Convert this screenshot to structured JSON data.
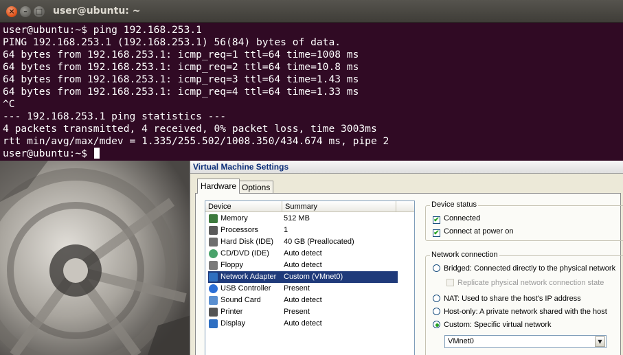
{
  "terminal": {
    "title": "user@ubuntu: ~",
    "buttons": {
      "close": "×",
      "minimize": "–",
      "maximize": "□"
    },
    "lines": [
      "user@ubuntu:~$ ping 192.168.253.1",
      "PING 192.168.253.1 (192.168.253.1) 56(84) bytes of data.",
      "64 bytes from 192.168.253.1: icmp_req=1 ttl=64 time=1008 ms",
      "64 bytes from 192.168.253.1: icmp_req=2 ttl=64 time=10.8 ms",
      "64 bytes from 192.168.253.1: icmp_req=3 ttl=64 time=1.43 ms",
      "64 bytes from 192.168.253.1: icmp_req=4 ttl=64 time=1.33 ms",
      "^C",
      "--- 192.168.253.1 ping statistics ---",
      "4 packets transmitted, 4 received, 0% packet loss, time 3003ms",
      "rtt min/avg/max/mdev = 1.335/255.502/1008.350/434.674 ms, pipe 2"
    ],
    "prompt": "user@ubuntu:~$ "
  },
  "dialog": {
    "title": "Virtual Machine Settings",
    "tabs": [
      "Hardware",
      "Options"
    ],
    "columns": [
      "Device",
      "Summary"
    ],
    "devices": [
      {
        "name": "Memory",
        "summary": "512 MB",
        "icon": "memory-icon",
        "color": "#3d7a3d"
      },
      {
        "name": "Processors",
        "summary": "1",
        "icon": "processor-icon",
        "color": "#5a5a5a"
      },
      {
        "name": "Hard Disk (IDE)",
        "summary": "40 GB (Preallocated)",
        "icon": "hard-disk-icon",
        "color": "#6e6e6e"
      },
      {
        "name": "CD/DVD (IDE)",
        "summary": "Auto detect",
        "icon": "cd-dvd-icon",
        "color": "#4aa36b"
      },
      {
        "name": "Floppy",
        "summary": "Auto detect",
        "icon": "floppy-icon",
        "color": "#7a7a7a"
      },
      {
        "name": "Network Adapter",
        "summary": "Custom (VMnet0)",
        "icon": "network-adapter-icon",
        "color": "#2f6fbf",
        "selected": true
      },
      {
        "name": "USB Controller",
        "summary": "Present",
        "icon": "usb-icon",
        "color": "#2a6ed6"
      },
      {
        "name": "Sound Card",
        "summary": "Auto detect",
        "icon": "sound-card-icon",
        "color": "#5a8fd0"
      },
      {
        "name": "Printer",
        "summary": "Present",
        "icon": "printer-icon",
        "color": "#555555"
      },
      {
        "name": "Display",
        "summary": "Auto detect",
        "icon": "display-icon",
        "color": "#2e6fc2"
      }
    ],
    "device_status": {
      "title": "Device status",
      "connected": {
        "label": "Connected",
        "checked": true
      },
      "connect_at_power_on": {
        "label": "Connect at power on",
        "checked": true
      }
    },
    "network_connection": {
      "title": "Network connection",
      "bridged": {
        "label": "Bridged: Connected directly to the physical network",
        "selected": false
      },
      "replicate": {
        "label": "Replicate physical network connection state",
        "checked": false,
        "disabled": true
      },
      "nat": {
        "label": "NAT: Used to share the host's IP address",
        "selected": false
      },
      "host_only": {
        "label": "Host-only: A private network shared with the host",
        "selected": false
      },
      "custom": {
        "label": "Custom: Specific virtual network",
        "selected": true
      },
      "custom_network_value": "VMnet0"
    }
  }
}
